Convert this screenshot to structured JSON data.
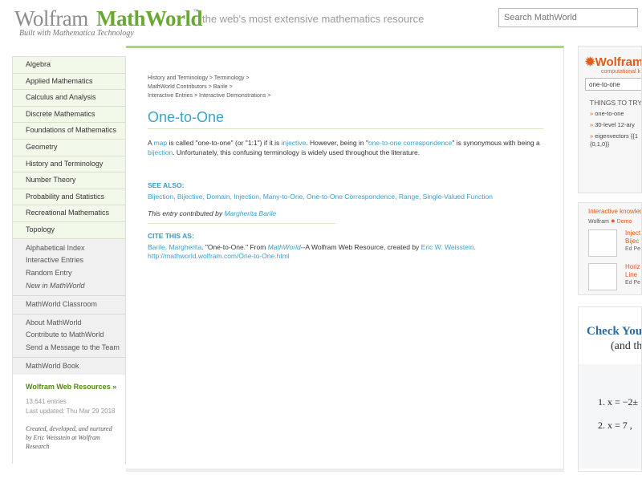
{
  "header": {
    "logo_wolfram": "Wolfram",
    "logo_mathworld": "MathWorld",
    "logo_tm": "™",
    "logo_sub": "Built with Mathematica Technology",
    "tagline": "the web's most extensive mathematics resource",
    "search_placeholder": "Search MathWorld"
  },
  "nav": {
    "topics": [
      "Algebra",
      "Applied Mathematics",
      "Calculus and Analysis",
      "Discrete Mathematics",
      "Foundations of Mathematics",
      "Geometry",
      "History and Terminology",
      "Number Theory",
      "Probability and Statistics",
      "Recreational Mathematics",
      "Topology"
    ],
    "group1": [
      "Alphabetical Index",
      "Interactive Entries",
      "Random Entry",
      "New in MathWorld"
    ],
    "group2": [
      "MathWorld Classroom"
    ],
    "group3": [
      "About MathWorld",
      "Contribute to MathWorld",
      "Send a Message to the Team"
    ],
    "group4": [
      "MathWorld Book"
    ],
    "resources": "Wolfram Web Resources »",
    "entries": "13,641 entries",
    "updated": "Last updated: Thu Mar 29 2018",
    "credit": "Created, developed, and nurtured by Eric Weisstein at Wolfram Research"
  },
  "main": {
    "breadcrumb1": "History and Terminology > Terminology >",
    "breadcrumb2": "MathWorld Contributors > Barile >",
    "breadcrumb3": "Interactive Entries > Interactive Demonstrations >",
    "title": "One-to-One",
    "para": {
      "t1": "A ",
      "l1": "map",
      "t2": " is called \"one-to-one\" (or \"1:1\") if it is ",
      "l2": "injective",
      "t3": ". However, being in \"",
      "l3": "one-to-one correspondence",
      "t4": "\" is synonymous with being a ",
      "l4": "bijection",
      "t5": ". Unfortunately, this confusing terminology is widely used throughout the literature."
    },
    "see_also_heading": "SEE ALSO:",
    "see_also": [
      "Bijection",
      "Bijective",
      "Domain",
      "Injection",
      "Many-to-One",
      "One-to-One Correspondence",
      "Range",
      "Single-Valued Function"
    ],
    "contrib_text": "This entry contributed by ",
    "contrib_name": "Margherita Barile",
    "cite_heading": "CITE THIS AS:",
    "cite": {
      "author": "Barile, Margherita",
      "t1": ". \"One-to-One.\" From ",
      "mw": "MathWorld",
      "t2": "--A Wolfram Web Resource, created by ",
      "eric": "Eric W. Weisstein",
      "t3": ".",
      "url": "http://mathworld.wolfram.com/One-to-One.html"
    }
  },
  "sidebar": {
    "wa_logo": "Wolfram",
    "wa_sub": "computational k",
    "wa_input": "one-to-one",
    "things_heading": "THINGS TO TRY",
    "things": [
      "one-to-one",
      "30-level 12-ary",
      "eigenvectors {{1",
      "{0,1,0}}"
    ],
    "ik_heading": "Interactive knowled",
    "ik_brand": "Wolfram",
    "ik_brand2": "Demo",
    "ik_items": [
      {
        "t1": "Inject",
        "t2": "Bijec",
        "author": "Ed Pe"
      },
      {
        "t1": "Horiz",
        "t2": "Line",
        "author": "Ed Pe"
      }
    ],
    "check1": "Check You",
    "check2": "(and th",
    "eq1": "1.  x = −2±",
    "eq2": "2.  x = 7 ,"
  }
}
